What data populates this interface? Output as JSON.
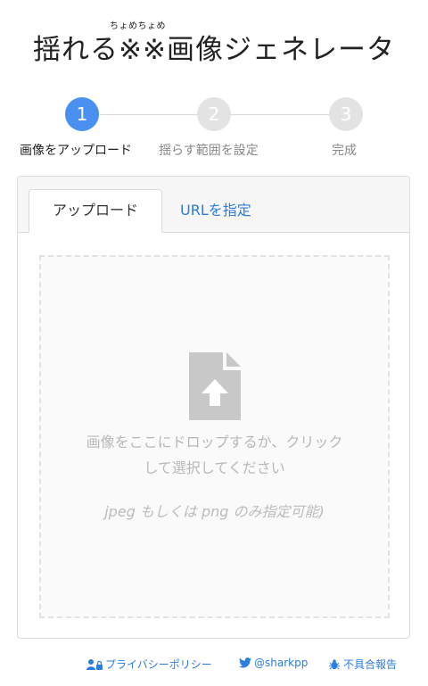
{
  "header": {
    "ruby": "ちょめちょめ",
    "title": "揺れる※※画像ジェネレータ"
  },
  "steps": [
    {
      "number": "1",
      "label": "画像をアップロード",
      "active": true
    },
    {
      "number": "2",
      "label": "揺らす範囲を設定",
      "active": false
    },
    {
      "number": "3",
      "label": "完成",
      "active": false
    }
  ],
  "tabs": {
    "upload": "アップロード",
    "url": "URLを指定"
  },
  "dropzone": {
    "line1": "画像をここにドロップするか、クリック",
    "line2": "して選択してください",
    "hint": "jpeg もしくは png のみ指定可能)"
  },
  "footer": {
    "privacy": "プライバシーポリシー",
    "twitter": "@sharkpp",
    "bug_report": "不具合報告"
  },
  "colors": {
    "accent": "#4a90f0",
    "link": "#2a7de1",
    "inactive_step": "#e3e3e3"
  },
  "icons": [
    "file-upload-icon",
    "user-lock-icon",
    "twitter-icon",
    "bug-icon"
  ]
}
